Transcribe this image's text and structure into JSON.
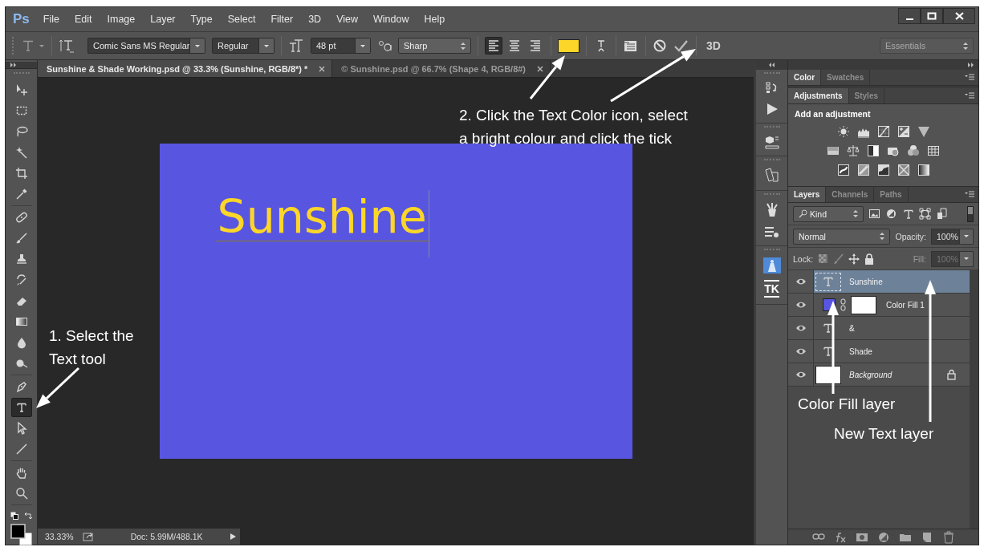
{
  "app": {
    "logo": "Ps"
  },
  "menu": [
    "File",
    "Edit",
    "Image",
    "Layer",
    "Type",
    "Select",
    "Filter",
    "3D",
    "View",
    "Window",
    "Help"
  ],
  "options_bar": {
    "font_family": "Comic Sans MS Regular",
    "font_style": "Regular",
    "font_size": "48 pt",
    "antialias": "Sharp",
    "alignment": [
      {
        "kind": "left",
        "selected": true
      },
      {
        "kind": "center",
        "selected": false
      },
      {
        "kind": "right",
        "selected": false
      }
    ],
    "text_swatch": {
      "color": "#fcd628"
    },
    "three_d": "3D",
    "workspace": "Essentials"
  },
  "document_tabs": [
    {
      "title": "Sunshine & Shade Working.psd @ 33.3% (Sunshine, RGB/8*) *",
      "selected": true
    },
    {
      "title": "© Sunshine.psd @ 66.7% (Shape 4, RGB/8#)",
      "selected": false
    }
  ],
  "canvas": {
    "text": "Sunshine"
  },
  "status_bar": {
    "zoom": "33.33%",
    "doc_info": "Doc: 5.99M/488.1K"
  },
  "tool_groups": [
    {
      "tools": [
        {
          "kind": "move",
          "selected": false
        },
        {
          "kind": "marquee",
          "selected": false
        },
        {
          "kind": "lasso",
          "selected": false
        },
        {
          "kind": "wand",
          "selected": false
        },
        {
          "kind": "crop",
          "selected": false
        },
        {
          "kind": "eyedropper",
          "selected": false
        }
      ]
    },
    {
      "tools": [
        {
          "kind": "heal",
          "selected": false
        },
        {
          "kind": "brush",
          "selected": false
        },
        {
          "kind": "stamp",
          "selected": false
        },
        {
          "kind": "history",
          "selected": false
        },
        {
          "kind": "eraser",
          "selected": false
        },
        {
          "kind": "gradient",
          "selected": false
        },
        {
          "kind": "blur",
          "selected": false
        },
        {
          "kind": "dodge",
          "selected": false
        }
      ]
    },
    {
      "tools": [
        {
          "kind": "pen",
          "selected": false
        },
        {
          "kind": "type",
          "selected": true
        },
        {
          "kind": "select",
          "selected": false
        },
        {
          "kind": "line",
          "selected": false
        }
      ]
    },
    {
      "tools": [
        {
          "kind": "hand",
          "selected": false
        },
        {
          "kind": "zoom",
          "selected": false
        }
      ]
    }
  ],
  "dock": {
    "label": "TK"
  },
  "color_panel": {
    "tabs": [
      {
        "label": "Color",
        "selected": true
      },
      {
        "label": "Swatches",
        "selected": false
      }
    ]
  },
  "adjustments_panel": {
    "tabs": [
      {
        "label": "Adjustments",
        "selected": true
      },
      {
        "label": "Styles",
        "selected": false
      }
    ],
    "heading": "Add an adjustment"
  },
  "layers_panel": {
    "tabs": [
      {
        "label": "Layers",
        "selected": true
      },
      {
        "label": "Channels",
        "selected": false
      },
      {
        "label": "Paths",
        "selected": false
      }
    ],
    "filter": "Kind",
    "blend_mode": "Normal",
    "opacity_label": "Opacity:",
    "opacity": "100%",
    "lock_label": "Lock:",
    "fill_label": "Fill:",
    "fill": {
      "value": "100%",
      "disabled": true
    },
    "layers": [
      {
        "name": "Sunshine",
        "kind": "text",
        "selected": true,
        "visible": true
      },
      {
        "name": "Color Fill 1",
        "kind": "fill",
        "color": "#5855e0",
        "selected": false,
        "visible": true
      },
      {
        "name": "&",
        "kind": "text",
        "selected": false,
        "visible": true
      },
      {
        "name": "Shade",
        "kind": "text",
        "selected": false,
        "visible": true
      },
      {
        "name": "Background",
        "kind": "background",
        "selected": false,
        "visible": true,
        "locked": true
      }
    ]
  },
  "annotations": [
    {
      "text": "2. Click the Text Color icon, select a bright colour and click the tick"
    },
    {
      "text": "1. Select the Text tool"
    },
    {
      "text": "Color Fill layer"
    },
    {
      "text": "New Text layer"
    }
  ]
}
